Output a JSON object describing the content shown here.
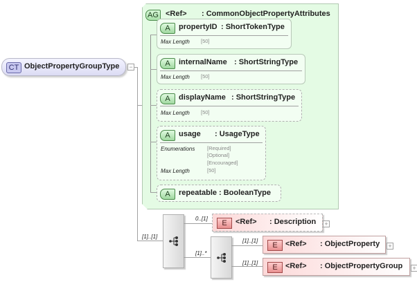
{
  "complex_type": {
    "badge": "CT",
    "name": "ObjectPropertyGroupType",
    "toggle": "−"
  },
  "attribute_group": {
    "badge": "AG",
    "ref": "<Ref>",
    "type": ": CommonObjectPropertyAttributes"
  },
  "attributes": [
    {
      "badge": "A",
      "name": "propertyID",
      "type": ": ShortTokenType",
      "facets": [
        {
          "label": "Max Length",
          "values": [
            "[50]"
          ]
        }
      ],
      "optional": false
    },
    {
      "badge": "A",
      "name": "internalName",
      "type": ": ShortStringType",
      "facets": [
        {
          "label": "Max Length",
          "values": [
            "[50]"
          ]
        }
      ],
      "optional": false
    },
    {
      "badge": "A",
      "name": "displayName",
      "type": ": ShortStringType",
      "facets": [
        {
          "label": "Max Length",
          "values": [
            "[50]"
          ]
        }
      ],
      "optional": true
    },
    {
      "badge": "A",
      "name": "usage",
      "type": ": UsageType",
      "facets": [
        {
          "label": "Enumerations",
          "values": [
            "[Required]",
            "[Optional]",
            "[Encouraged]"
          ]
        },
        {
          "label": "Max Length",
          "values": [
            "[50]"
          ]
        }
      ],
      "optional": true
    },
    {
      "badge": "A",
      "name": "repeatable",
      "type": ": BooleanType",
      "facets": [],
      "optional": true
    }
  ],
  "sequence": {
    "cardinality": "[1]..[1]"
  },
  "elements": [
    {
      "badge": "E",
      "ref": "<Ref>",
      "name": ": Description",
      "cardinality": "0..[1]",
      "toggle": "+",
      "optional": true
    },
    {
      "badge": "E",
      "ref": "<Ref>",
      "name": ": ObjectProperty",
      "cardinality": "[1]..[1]",
      "toggle": "+"
    },
    {
      "badge": "E",
      "ref": "<Ref>",
      "name": ": ObjectPropertyGroup",
      "cardinality": "[1]..[1]",
      "toggle": "+"
    }
  ],
  "inner_sequence": {
    "cardinality": "[1]..*"
  },
  "colors": {
    "attribute_group_bg": "#e4fbe4",
    "element_bg": "#fcd8d8",
    "complex_type_bg": "#dcdcf4"
  }
}
